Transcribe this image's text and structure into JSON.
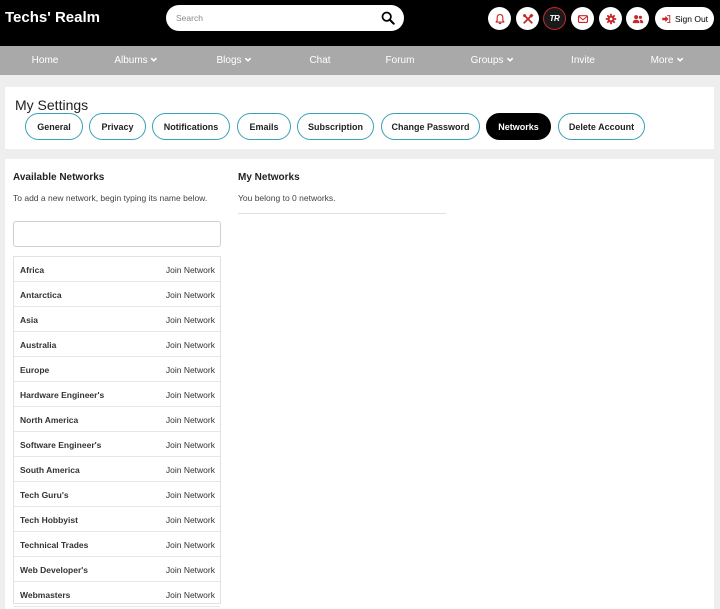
{
  "header": {
    "brand": "Techs' Realm",
    "search_placeholder": "Search",
    "avatar_initials": "TR",
    "sign_out_label": "Sign Out",
    "icons": [
      "bell-icon",
      "tools-icon",
      "envelope-icon",
      "gear-icon",
      "users-icon",
      "sign-out-icon"
    ],
    "accent_color": "#c62828"
  },
  "nav": {
    "items": [
      {
        "label": "Home"
      },
      {
        "label": "Albums"
      },
      {
        "label": "Blogs"
      },
      {
        "label": "Chat"
      },
      {
        "label": "Forum"
      },
      {
        "label": "Groups"
      },
      {
        "label": "Invite"
      },
      {
        "label": "More"
      }
    ]
  },
  "settings": {
    "title": "My Settings",
    "tabs": [
      {
        "label": "General"
      },
      {
        "label": "Privacy"
      },
      {
        "label": "Notifications"
      },
      {
        "label": "Emails"
      },
      {
        "label": "Subscription"
      },
      {
        "label": "Change Password"
      },
      {
        "label": "Networks",
        "active": true
      },
      {
        "label": "Delete Account"
      }
    ]
  },
  "available": {
    "title": "Available Networks",
    "description": "To add a new network, begin typing its name below.",
    "input_value": "",
    "join_label": "Join Network",
    "networks": [
      "Africa",
      "Antarctica",
      "Asia",
      "Australia",
      "Europe",
      "Hardware Engineer's",
      "North America",
      "Software Engineer's",
      "South America",
      "Tech Guru's",
      "Tech Hobbyist",
      "Technical Trades",
      "Web Developer's",
      "Webmasters"
    ]
  },
  "mine": {
    "title": "My Networks",
    "description": "You belong to 0 networks."
  }
}
